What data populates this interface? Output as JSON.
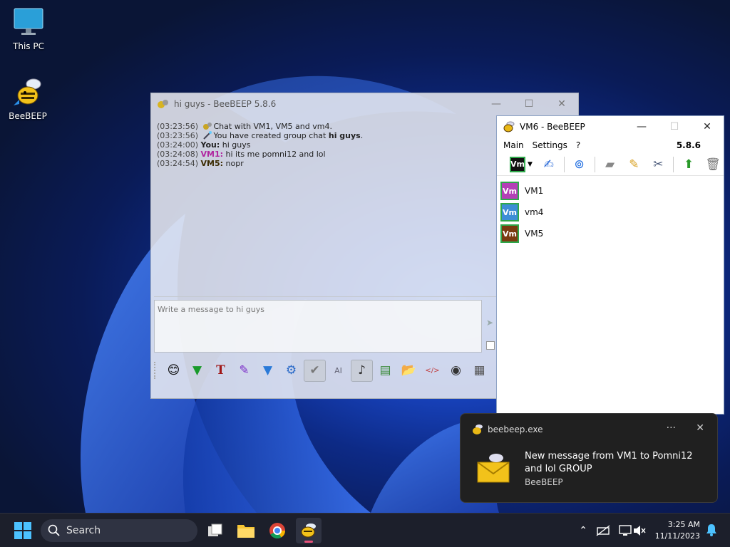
{
  "desktop": {
    "icons": [
      {
        "label": "This PC"
      },
      {
        "label": "BeeBEEP"
      }
    ]
  },
  "chat_window": {
    "title": "hi guys - BeeBEEP 5.8.6",
    "messages": [
      {
        "time": "(03:23:56)",
        "text": "Chat with VM1, VM5 and vm4."
      },
      {
        "time": "(03:23:56)",
        "text_pre": "You have created group chat ",
        "bold": "hi guys",
        "text_post": "."
      },
      {
        "time": "(03:24:00)",
        "sender": "You:",
        "text": " hi guys"
      },
      {
        "time": "(03:24:08)",
        "sender": "VM1:",
        "text": " hi its me pomni12 and lol"
      },
      {
        "time": "(03:24:54)",
        "sender": "VM5:",
        "text": " nopr"
      }
    ],
    "input_placeholder": "Write a message to hi guys"
  },
  "contact_window": {
    "title": "VM6 - BeeBEEP",
    "menu": [
      "Main",
      "Settings",
      "?"
    ],
    "version": "5.8.6",
    "status_badge": "Vm",
    "users": [
      {
        "badge": "Vm",
        "name": "VM1",
        "color": "#b43fb6"
      },
      {
        "badge": "Vm",
        "name": "vm4",
        "color": "#3d8ed6"
      },
      {
        "badge": "Vm",
        "name": "VM5",
        "color": "#7a3b10"
      }
    ]
  },
  "notification": {
    "app": "beebeep.exe",
    "message": "New message from VM1 to Pomni12 and lol GROUP",
    "source": "BeeBEEP",
    "more": "···",
    "close": "✕"
  },
  "taskbar": {
    "search_label": "Search",
    "time": "3:25 AM",
    "date": "11/11/2023"
  },
  "colors": {
    "you": "#000000",
    "vm1": "#b0259f",
    "vm5": "#3a2a00",
    "badge_border": "#2ea84a"
  }
}
